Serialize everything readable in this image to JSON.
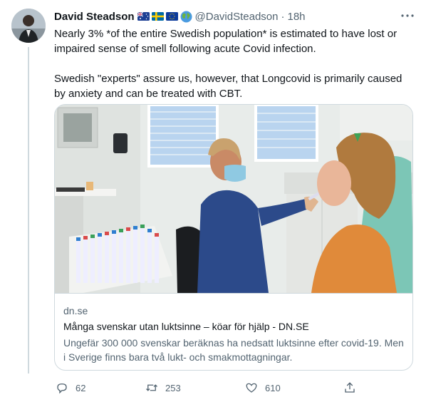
{
  "tweet": {
    "author_name": "David Steadson",
    "author_handle": "@DavidSteadson",
    "separator": "·",
    "time": "18h",
    "paragraphs": [
      "Nearly 3% *of the entire Swedish population* is estimated to have lost or impaired sense of smell following acute Covid infection.",
      "Swedish \"experts\" assure us, however, that Longcovid  is primarily caused by anxiety and can be treated with CBT."
    ],
    "flag_icons": [
      "australia-flag-icon",
      "sweden-flag-icon",
      "eu-flag-icon",
      "globe-icon"
    ]
  },
  "card": {
    "domain": "dn.se",
    "title": "Många svenskar utan luktsinne – köar för hjälp - DN.SE",
    "description": "Ungefär 300 000 svenskar beräknas ha nedsatt luktsinne efter covid-19. Men i Sverige finns bara två lukt- och smakmottagningar."
  },
  "actions": {
    "replies": "62",
    "retweets": "253",
    "likes": "610"
  },
  "colors": {
    "text": "#0f1419",
    "secondary": "#536471",
    "border": "#cfd9de"
  }
}
